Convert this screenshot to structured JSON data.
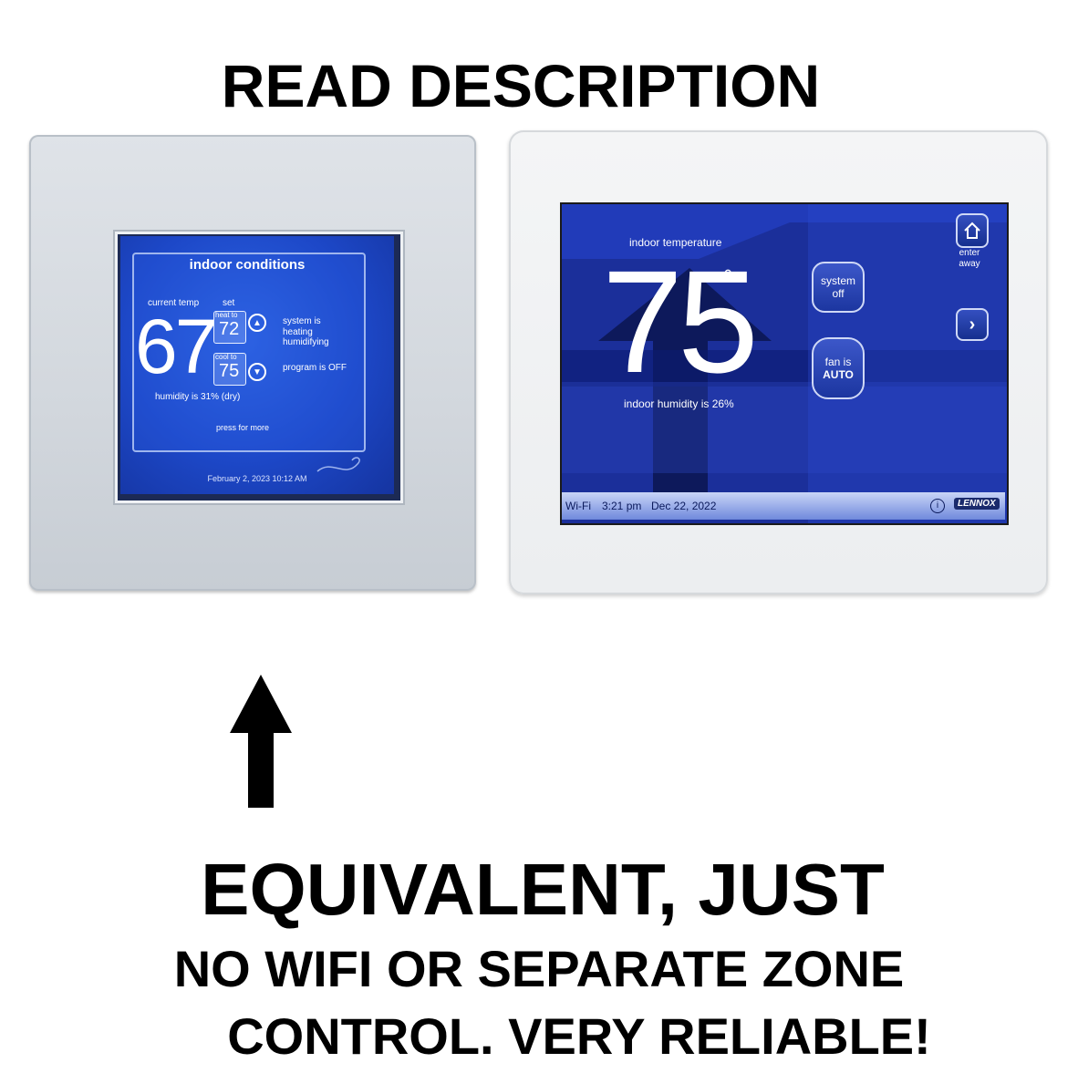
{
  "top_heading": "READ DESCRIPTION",
  "left_thermostat": {
    "title": "indoor conditions",
    "current_temp_label": "current temp",
    "set_label": "set",
    "current_temp": "67",
    "heat_to_label": "heat to",
    "heat_to_value": "72",
    "cool_to_label": "cool to",
    "cool_to_value": "75",
    "system_status": [
      "system is",
      "heating",
      "humidifying"
    ],
    "program_status": "program is OFF",
    "humidity": "humidity is 31% (dry)",
    "press_for_more": "press for more",
    "datetime": "February 2, 2023 10:12 AM"
  },
  "right_thermostat": {
    "indoor_temp_label": "indoor temperature",
    "indoor_temp": "75",
    "degree": "°",
    "humidity": "indoor humidity is 26%",
    "system_button": [
      "system",
      "off"
    ],
    "fan_button": [
      "fan is",
      "AUTO"
    ],
    "enter_away": [
      "enter",
      "away"
    ],
    "status_bar": {
      "wifi": "Wi-Fi",
      "time": "3:21 pm",
      "date": "Dec 22, 2022",
      "brand": "LENNOX"
    }
  },
  "bottom_heading": {
    "line1": "EQUIVALENT, JUST",
    "line2": "NO WIFI OR SEPARATE ZONE",
    "line3": "CONTROL. VERY RELIABLE!"
  }
}
